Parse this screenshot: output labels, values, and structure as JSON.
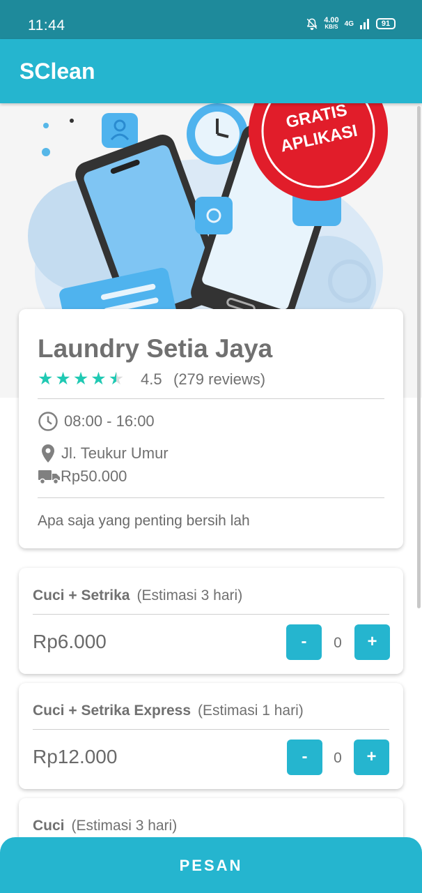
{
  "status_bar": {
    "time": "11:44",
    "net_speed": "4.00",
    "net_speed_unit": "KB/S",
    "network": "4G",
    "battery": "91"
  },
  "app": {
    "title": "SClean"
  },
  "banner": {
    "badge_line1": "GRATIS",
    "badge_line2": "APLIKASI"
  },
  "laundry": {
    "name": "Laundry Setia Jaya",
    "rating": 4.5,
    "rating_text": "4.5",
    "reviews": "(279 reviews)",
    "hours": "08:00 - 16:00",
    "address": "Jl. Teukur Umur",
    "delivery": "Rp50.000",
    "description": "Apa saja yang penting bersih lah"
  },
  "services": [
    {
      "name": "Cuci + Setrika",
      "estimate": "(Estimasi 3 hari)",
      "price": "Rp6.000",
      "qty": "0"
    },
    {
      "name": "Cuci + Setrika Express",
      "estimate": "(Estimasi 1 hari)",
      "price": "Rp12.000",
      "qty": "0"
    },
    {
      "name": "Cuci",
      "estimate": "(Estimasi 3 hari)"
    }
  ],
  "buttons": {
    "minus": "-",
    "plus": "+",
    "order": "PESAN"
  },
  "colors": {
    "primary": "#25b5cf",
    "status_bar": "#1e8a9b",
    "star": "#20c9b3",
    "text": "#707070"
  }
}
